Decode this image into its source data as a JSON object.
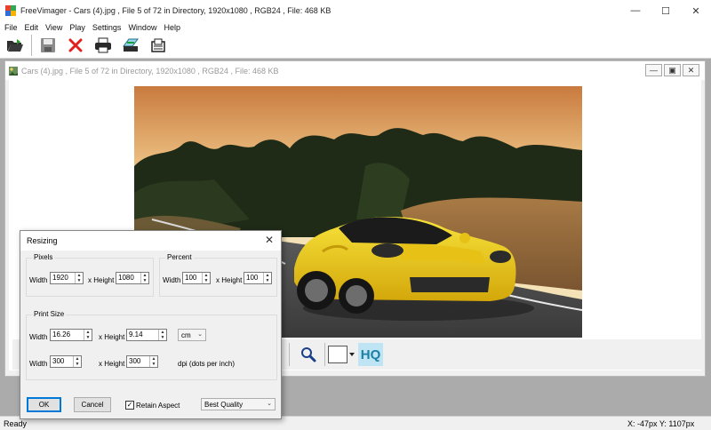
{
  "window": {
    "title": "FreeVimager - Cars (4).jpg , File 5 of 72 in Directory, 1920x1080 , RGB24 , File: 468 KB",
    "controls": {
      "minimize": "—",
      "maximize": "☐",
      "close": "✕"
    }
  },
  "menu": [
    "File",
    "Edit",
    "View",
    "Play",
    "Settings",
    "Window",
    "Help"
  ],
  "toolbar": {
    "icons": [
      "open-folder-icon",
      "save-icon",
      "delete-icon",
      "print-icon",
      "scan-icon",
      "email-icon"
    ]
  },
  "document": {
    "title": "Cars (4).jpg , File 5 of 72 in Directory, 1920x1080 , RGB24 , File: 468 KB",
    "controls": {
      "minimize": "—",
      "maximize": "▣",
      "close": "✕"
    }
  },
  "viewer_bar": {
    "hq_label": "HQ"
  },
  "status": {
    "left": "Ready",
    "coords": "X: -47px   Y: 1107px"
  },
  "dialog": {
    "title": "Resizing",
    "close": "✕",
    "pixels": {
      "label": "Pixels",
      "width_label": "Width",
      "width_value": "1920",
      "height_label": "x Height",
      "height_value": "1080"
    },
    "percent": {
      "label": "Percent",
      "width_label": "Width",
      "width_value": "100",
      "height_label": "x Height",
      "height_value": "100"
    },
    "print_size": {
      "label": "Print Size",
      "width_label": "Width",
      "width_value": "16.26",
      "height_label": "x Height",
      "height_value": "9.14",
      "unit": "cm",
      "dpi_width_label": "Width",
      "dpi_width_value": "300",
      "dpi_height_label": "x Height",
      "dpi_height_value": "300",
      "dpi_label": "dpi (dots per inch)"
    },
    "ok_label": "OK",
    "cancel_label": "Cancel",
    "retain_aspect_label": "Retain Aspect",
    "retain_aspect_checked": true,
    "retain_aspect_mark": "✓",
    "quality": "Best Quality"
  }
}
